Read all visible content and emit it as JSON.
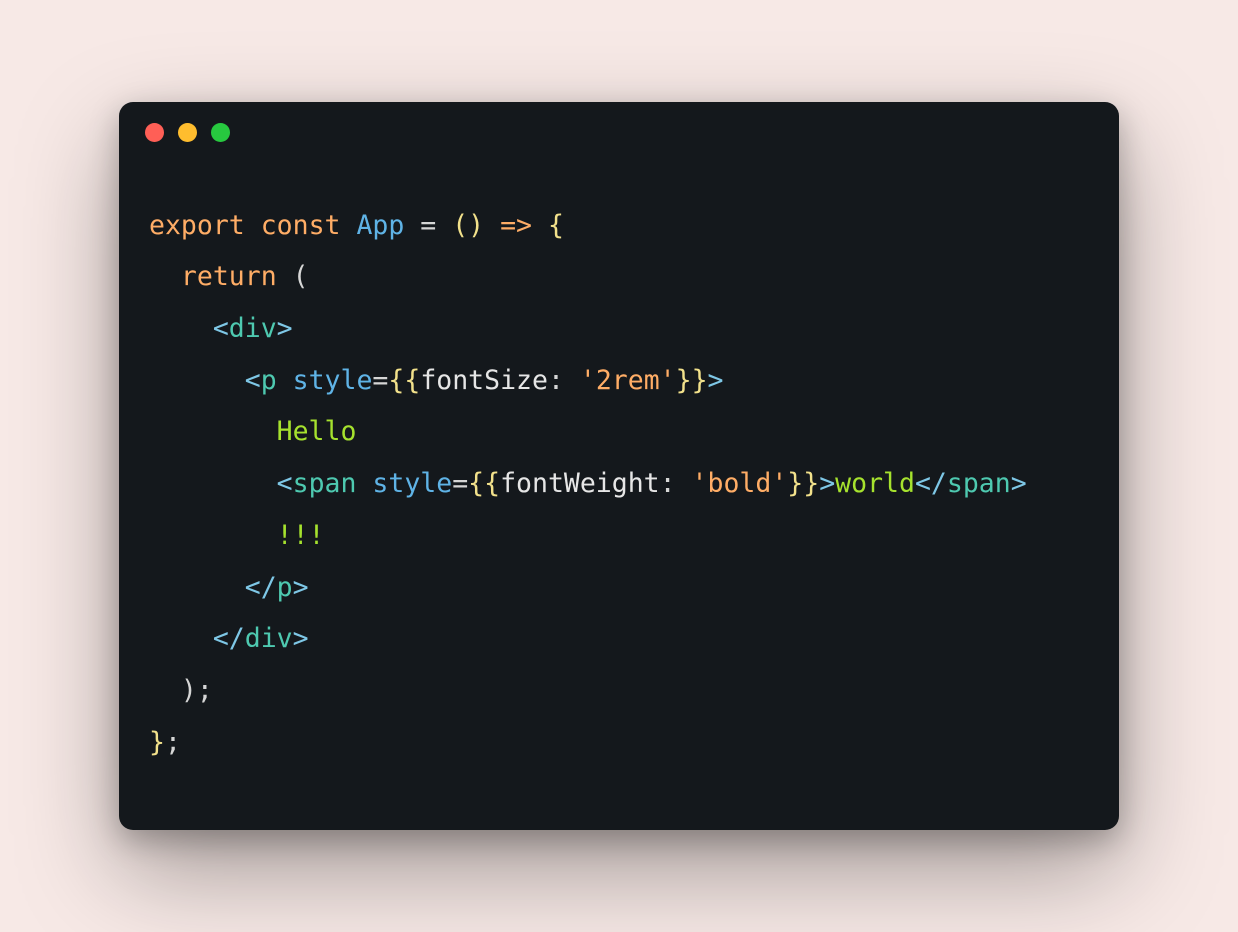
{
  "window": {
    "traffic": {
      "close_color": "#ff5f56",
      "minimize_color": "#ffbd2e",
      "maximize_color": "#27c93f"
    }
  },
  "code": {
    "kw_export": "export",
    "kw_const": "const",
    "id_app": "App",
    "op_eq1": " = ",
    "parens_empty": "()",
    "arrow": " => ",
    "brace_open": "{",
    "kw_return": "return",
    "paren_open": " (",
    "tag_div": "div",
    "tag_p": "p",
    "tag_span": "span",
    "lt": "<",
    "gt": ">",
    "slash": "/",
    "attr_style": "style",
    "eq": "=",
    "dbl_brace_open": "{{",
    "dbl_brace_close": "}}",
    "prop_fontSize": "fontSize",
    "prop_fontWeight": "fontWeight",
    "colon_sp": ": ",
    "str_2rem": "'2rem'",
    "str_bold": "'bold'",
    "txt_hello": "Hello",
    "txt_world": "world",
    "txt_bangs": "!!!",
    "paren_close": ")",
    "semi": ";",
    "brace_close": "}",
    "indent1": "  ",
    "indent2": "    ",
    "indent3": "      ",
    "indent4": "        ",
    "sp": " "
  }
}
